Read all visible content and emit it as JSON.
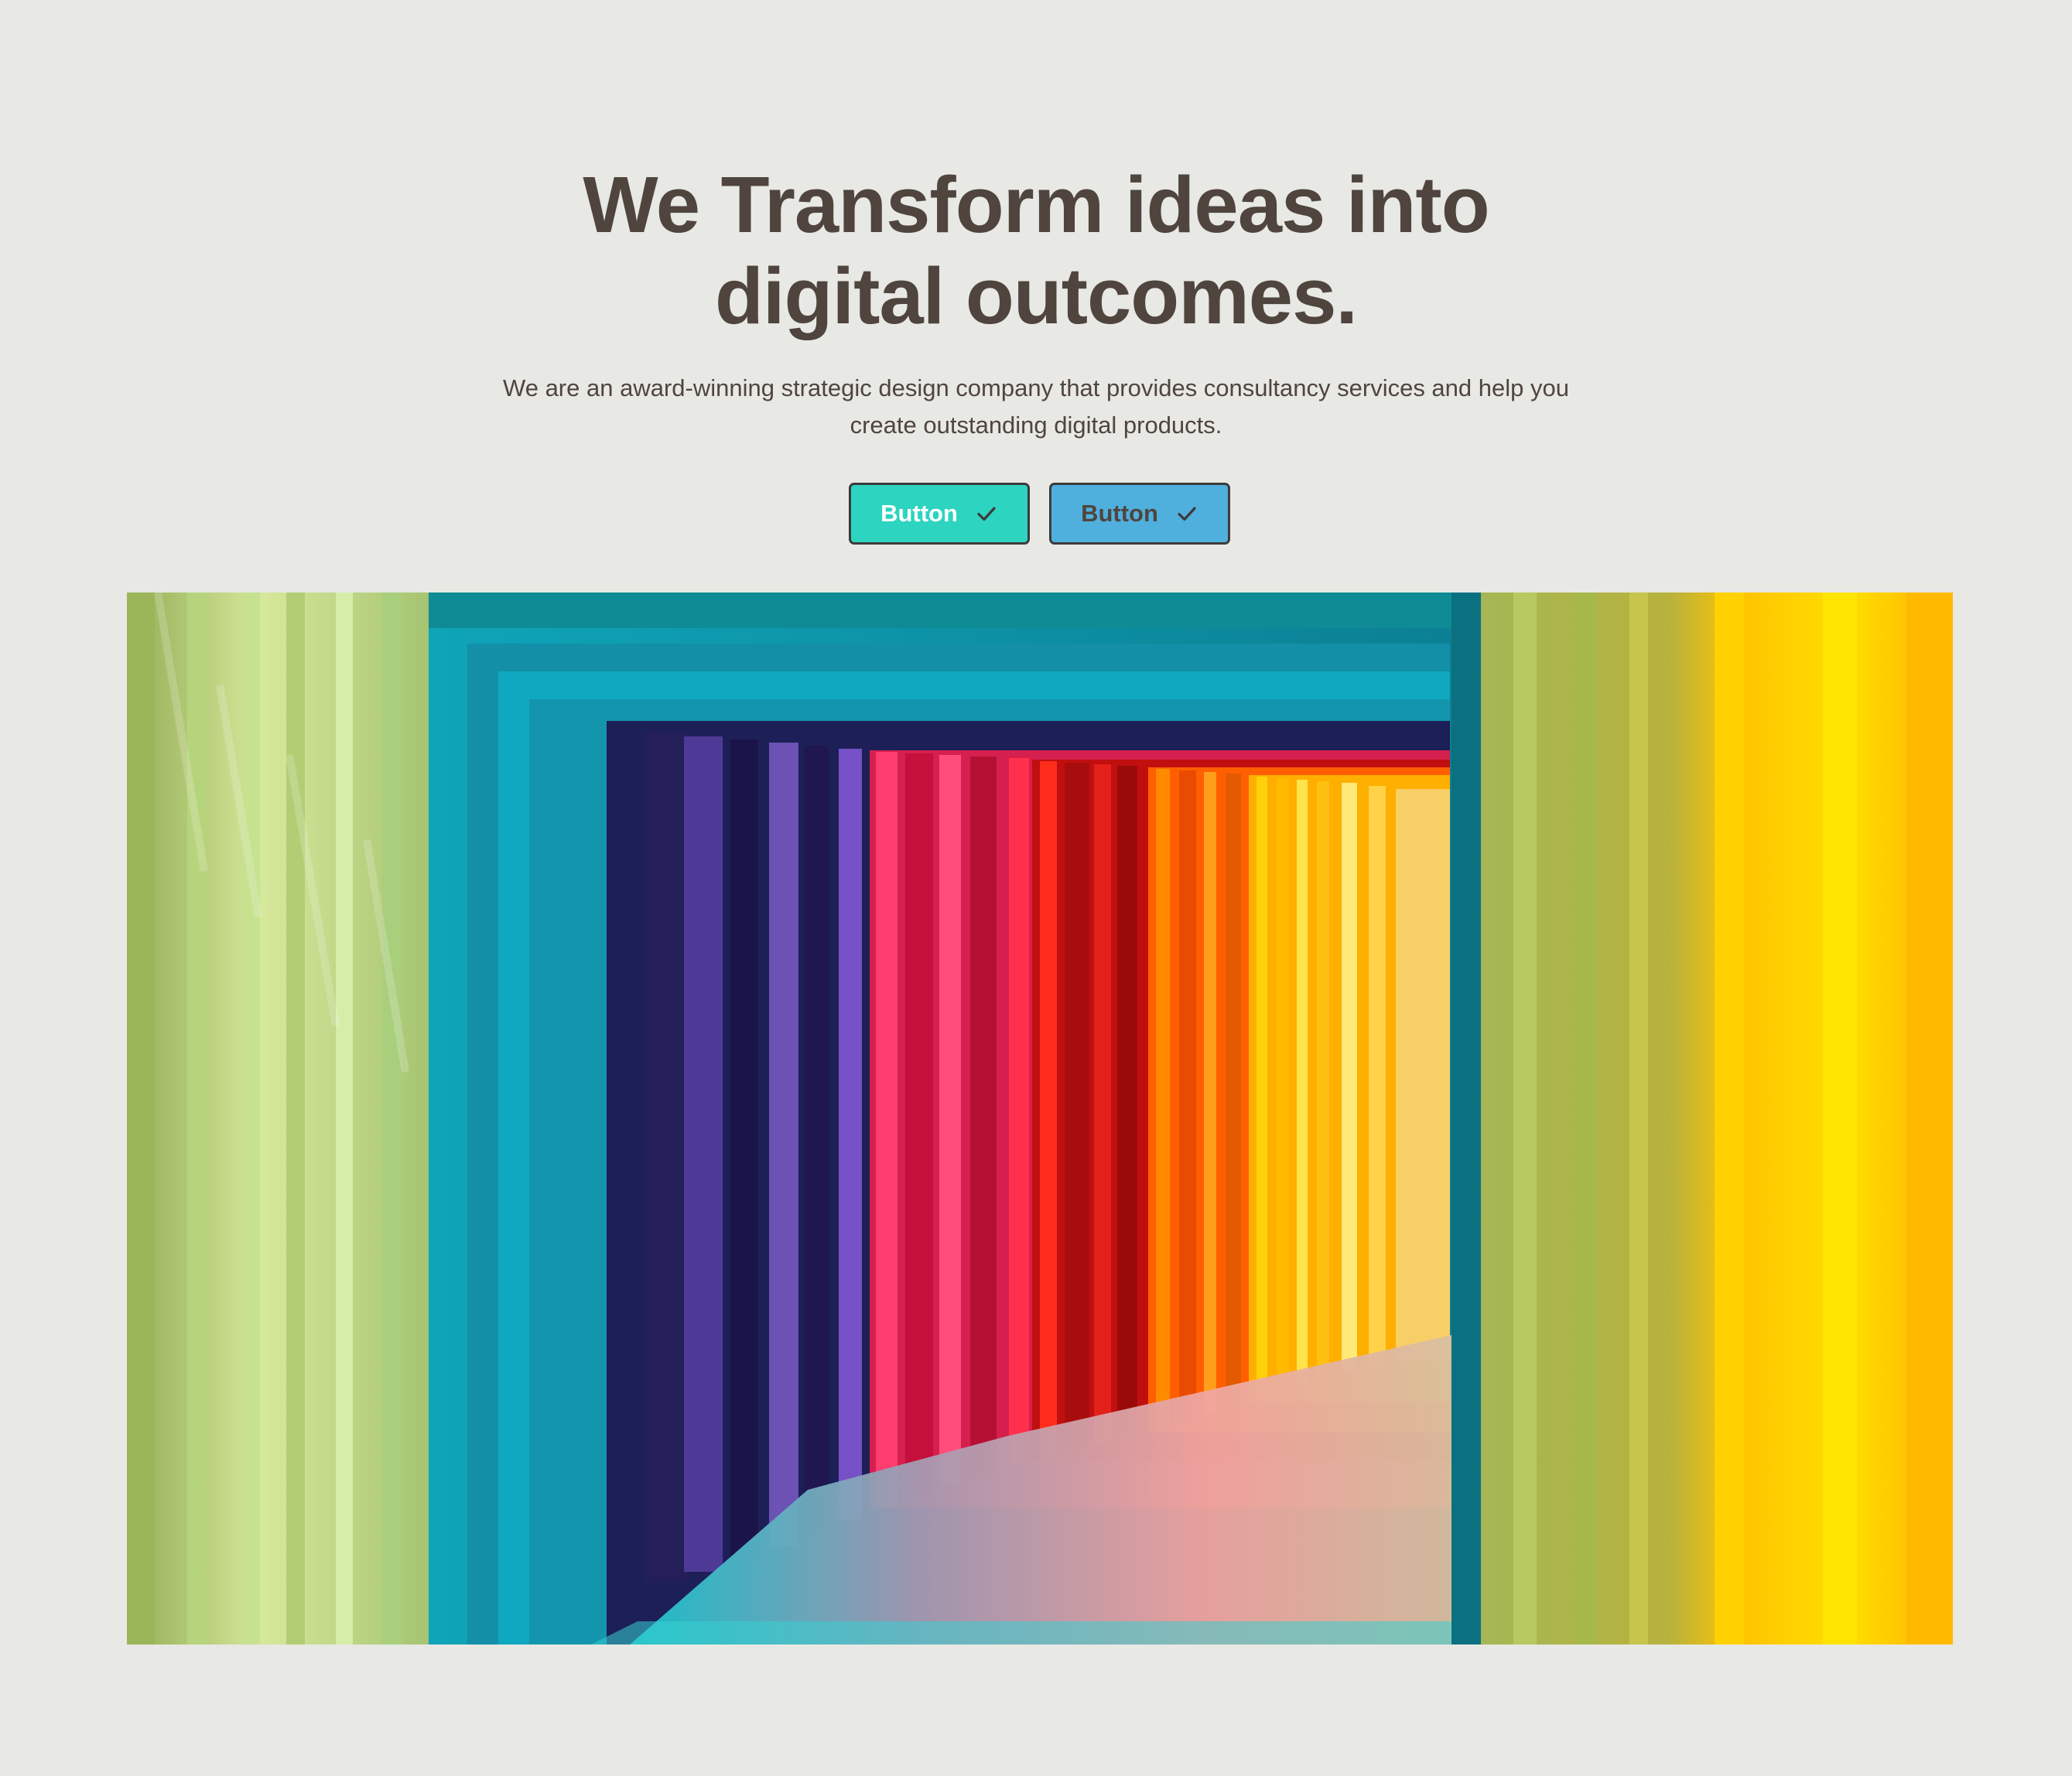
{
  "hero": {
    "headline_line1": "We Transform ideas into",
    "headline_line2": "digital outcomes.",
    "subtext": "We are an award-winning strategic design company that provides consultancy services and help you create outstanding digital products.",
    "primary_button_label": "Button",
    "secondary_button_label": "Button",
    "primary_button_icon": "check-icon",
    "secondary_button_icon": "check-icon",
    "image_subject": "rainbow-colored wooden tunnel"
  },
  "colors": {
    "background": "#e8e8e4",
    "text": "#4f453e",
    "primary_button": "#2dd4bf",
    "secondary_button": "#4fb0de",
    "button_border": "#3d3a3a"
  }
}
